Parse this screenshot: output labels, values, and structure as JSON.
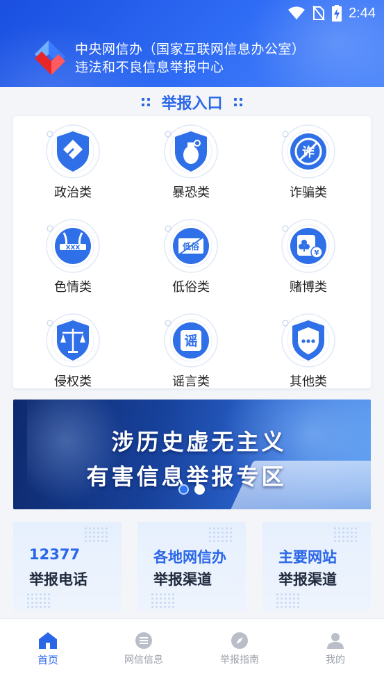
{
  "status_bar": {
    "time": "2:44"
  },
  "header": {
    "title_line1": "中央网信办（国家互联网信息办公室）",
    "title_line2": "违法和不良信息举报中心"
  },
  "section": {
    "title": "举报入口"
  },
  "categories": [
    {
      "label": "政治类",
      "icon": "shield-diamond-icon"
    },
    {
      "label": "暴恐类",
      "icon": "grenade-icon"
    },
    {
      "label": "诈骗类",
      "icon": "no-fraud-icon"
    },
    {
      "label": "色情类",
      "icon": "censored-body-icon"
    },
    {
      "label": "低俗类",
      "icon": "vulgar-banned-icon"
    },
    {
      "label": "赌博类",
      "icon": "gambling-card-icon"
    },
    {
      "label": "侵权类",
      "icon": "justice-scale-icon"
    },
    {
      "label": "谣言类",
      "icon": "rumor-icon"
    },
    {
      "label": "其他类",
      "icon": "shield-more-icon"
    }
  ],
  "banner": {
    "line1": "涉历史虚无主义",
    "line2": "有害信息举报专区",
    "active_page": 1,
    "page_count": 2
  },
  "quick_links": [
    {
      "line1": "12377",
      "line2": "举报电话"
    },
    {
      "line1": "各地网信办",
      "line2": "举报渠道"
    },
    {
      "line1": "主要网站",
      "line2": "举报渠道"
    }
  ],
  "nav": [
    {
      "label": "首页",
      "icon": "home-icon",
      "active": true
    },
    {
      "label": "网信信息",
      "icon": "list-icon",
      "active": false
    },
    {
      "label": "举报指南",
      "icon": "compass-icon",
      "active": false
    },
    {
      "label": "我的",
      "icon": "user-icon",
      "active": false
    }
  ],
  "colors": {
    "accent": "#2a66e8",
    "header_blue": "#2f6cf5",
    "icon_blue": "#2f6fe8",
    "nav_inactive": "#9aa0aa"
  }
}
